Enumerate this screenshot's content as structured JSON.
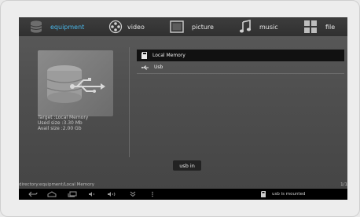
{
  "tabs": [
    {
      "label": "equipment",
      "icon": "database-icon",
      "active": true
    },
    {
      "label": "video",
      "icon": "film-reel-icon",
      "active": false
    },
    {
      "label": "picture",
      "icon": "picture-icon",
      "active": false
    },
    {
      "label": "music",
      "icon": "music-note-icon",
      "active": false
    },
    {
      "label": "file",
      "icon": "grid-icon",
      "active": false
    }
  ],
  "info": {
    "target": "Target :Local Memory",
    "used": "Used size :3.30 Mb",
    "avail": "Avail size :2.00 Gb"
  },
  "list": [
    {
      "label": "Local Memory",
      "icon": "sd-card-icon",
      "selected": true
    },
    {
      "label": "Usb",
      "icon": "usb-icon",
      "selected": false
    }
  ],
  "toast": "usb in",
  "path": "directory:equipment/Local Memory",
  "page_indicator": "1/1",
  "status": {
    "notification": "usb is mounted"
  },
  "colors": {
    "accent": "#49b6e8",
    "background": "#4f4f4f"
  }
}
